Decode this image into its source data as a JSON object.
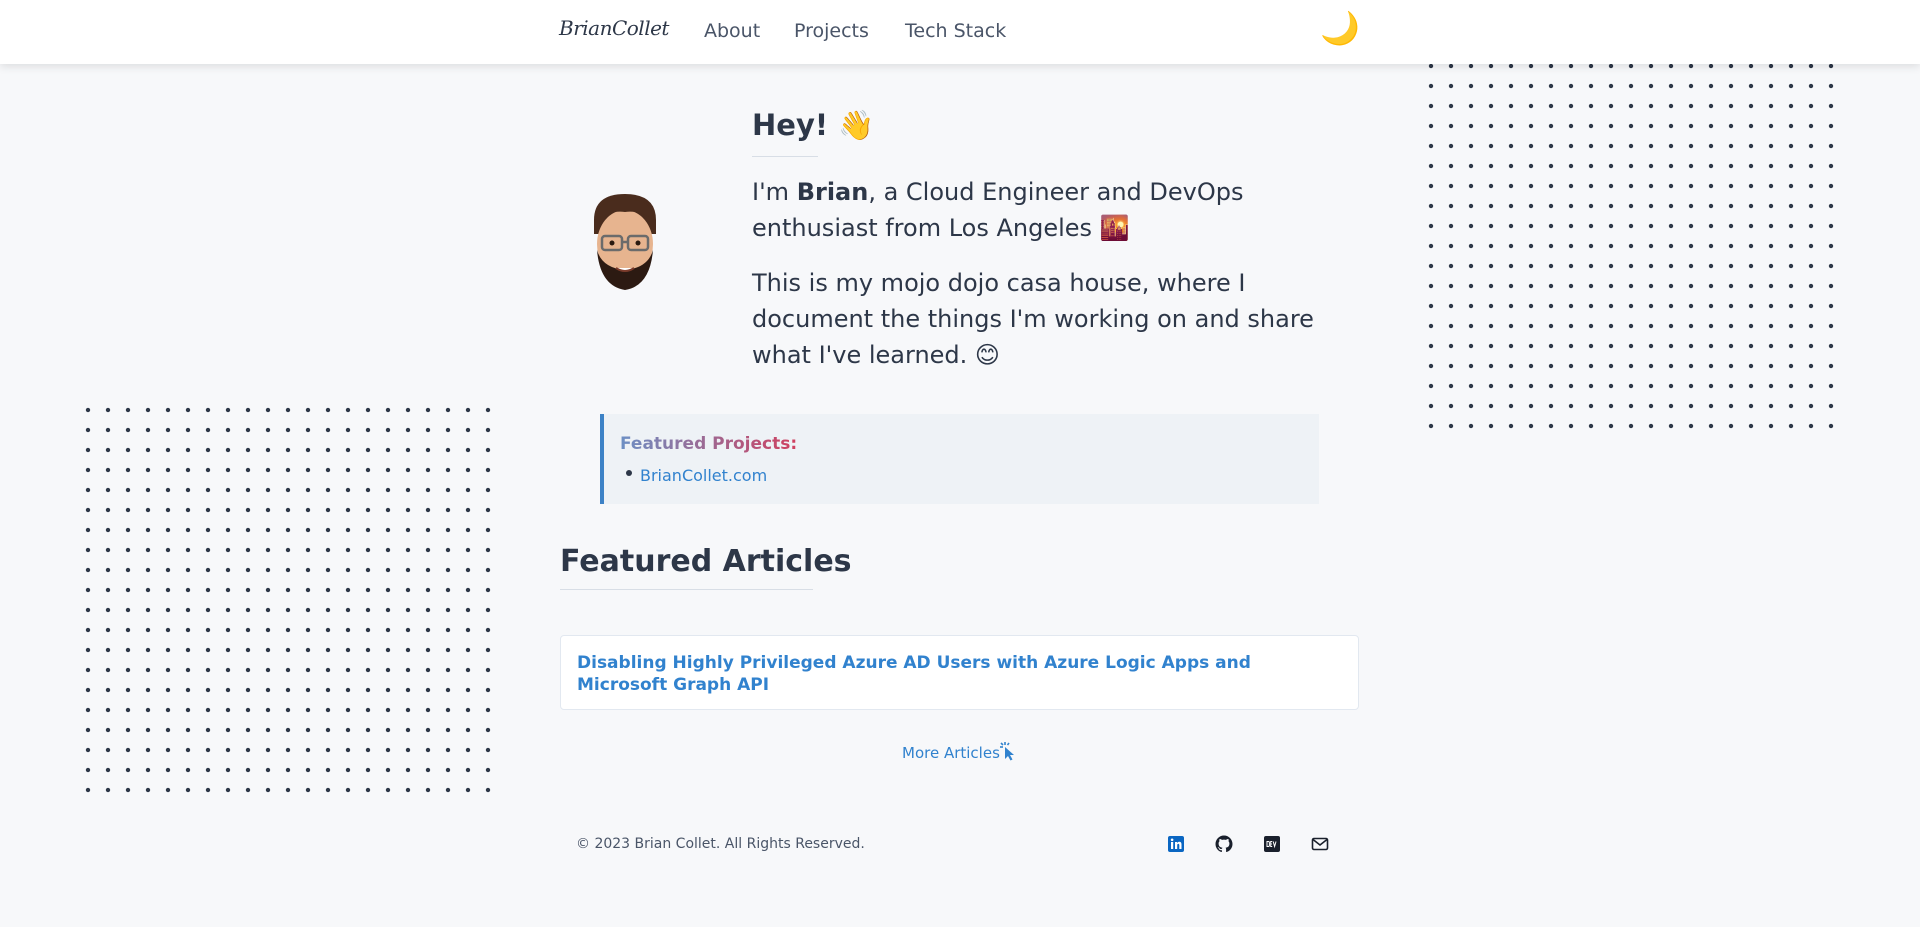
{
  "nav": {
    "logo": "BrianCollet",
    "links": [
      "About",
      "Projects",
      "Tech Stack"
    ],
    "theme_toggle_glyph": "🌙"
  },
  "intro": {
    "greeting": "Hey! 👋",
    "line1_prefix": "I'm ",
    "line1_name": "Brian",
    "line1_suffix": ", a Cloud Engineer and DevOps enthusiast from Los Angeles 🌇",
    "line2": "This is my mojo dojo casa house, where I document the things I'm working on and share what I've learned. 😊"
  },
  "featured_projects": {
    "title": "Featured Projects:",
    "items": [
      "BrianCollet.com"
    ]
  },
  "featured_articles": {
    "title": "Featured Articles",
    "articles": [
      "Disabling Highly Privileged Azure AD Users with Azure Logic Apps and Microsoft Graph API"
    ],
    "more_label": "More Articles"
  },
  "footer": {
    "copyright": "© 2023 Brian Collet. All Rights Reserved.",
    "social_icons": [
      "linkedin-icon",
      "github-icon",
      "dev-icon",
      "mail-icon"
    ]
  },
  "colors": {
    "accent": "#3182ce",
    "text": "#2d3748",
    "background": "#f7f8fa",
    "linkedin": "#0a66c2"
  }
}
